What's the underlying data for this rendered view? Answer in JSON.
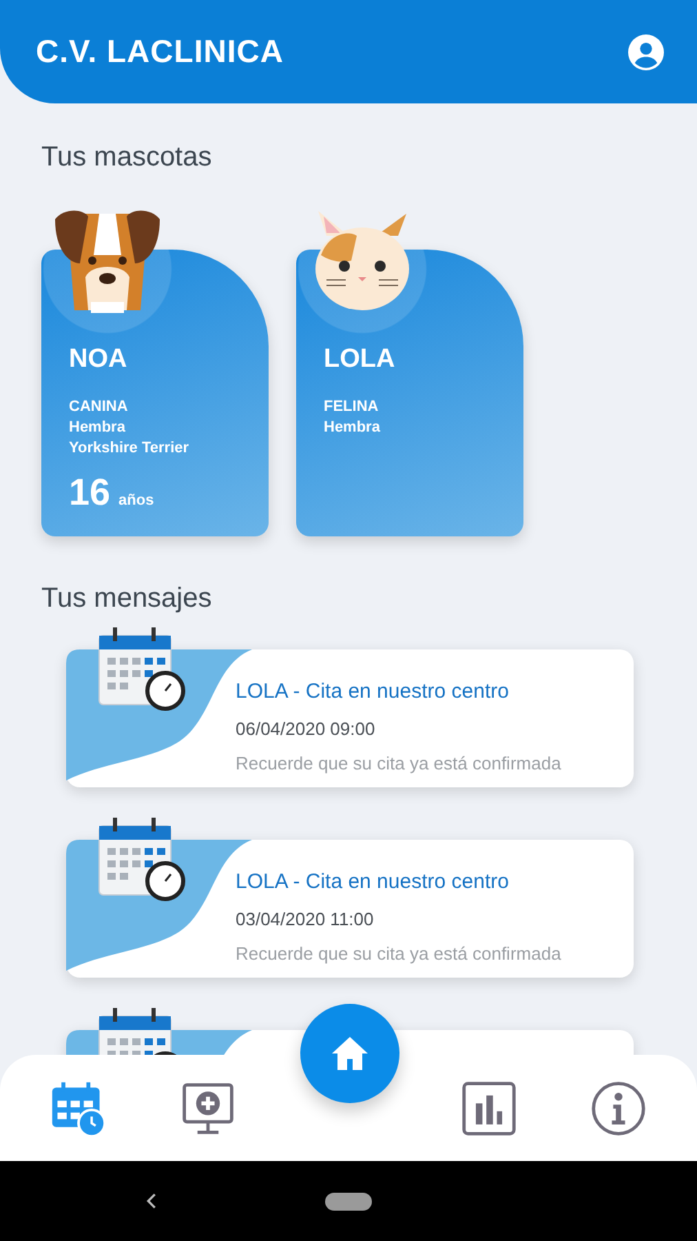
{
  "app_bar": {
    "title": "C.V. LACLINICA"
  },
  "pets_section": {
    "title": "Tus mascotas",
    "pets": [
      {
        "name": "NOA",
        "kind": "dog",
        "details": [
          "CANINA",
          "Hembra",
          "Yorkshire Terrier"
        ],
        "age": "16",
        "age_unit": "años"
      },
      {
        "name": "LOLA",
        "kind": "cat",
        "details": [
          "FELINA",
          "Hembra"
        ]
      }
    ]
  },
  "messages_section": {
    "title": "Tus mensajes",
    "messages": [
      {
        "kind": "appointment",
        "title": "LOLA - Cita en nuestro centro",
        "date": "06/04/2020 09:00",
        "text": "Recuerde que su cita ya está confirmada"
      },
      {
        "kind": "appointment",
        "title": "LOLA - Cita en nuestro centro",
        "date": "03/04/2020 11:00",
        "text": "Recuerde que su cita ya está confirmada"
      },
      {
        "kind": "appointment"
      }
    ]
  },
  "bottom_nav": {
    "items": [
      {
        "kind": "calendar",
        "selected": true
      },
      {
        "kind": "monitor",
        "selected": false
      },
      {
        "kind": "home",
        "selected": false
      },
      {
        "kind": "chart",
        "selected": false
      },
      {
        "kind": "info",
        "selected": false
      }
    ]
  }
}
